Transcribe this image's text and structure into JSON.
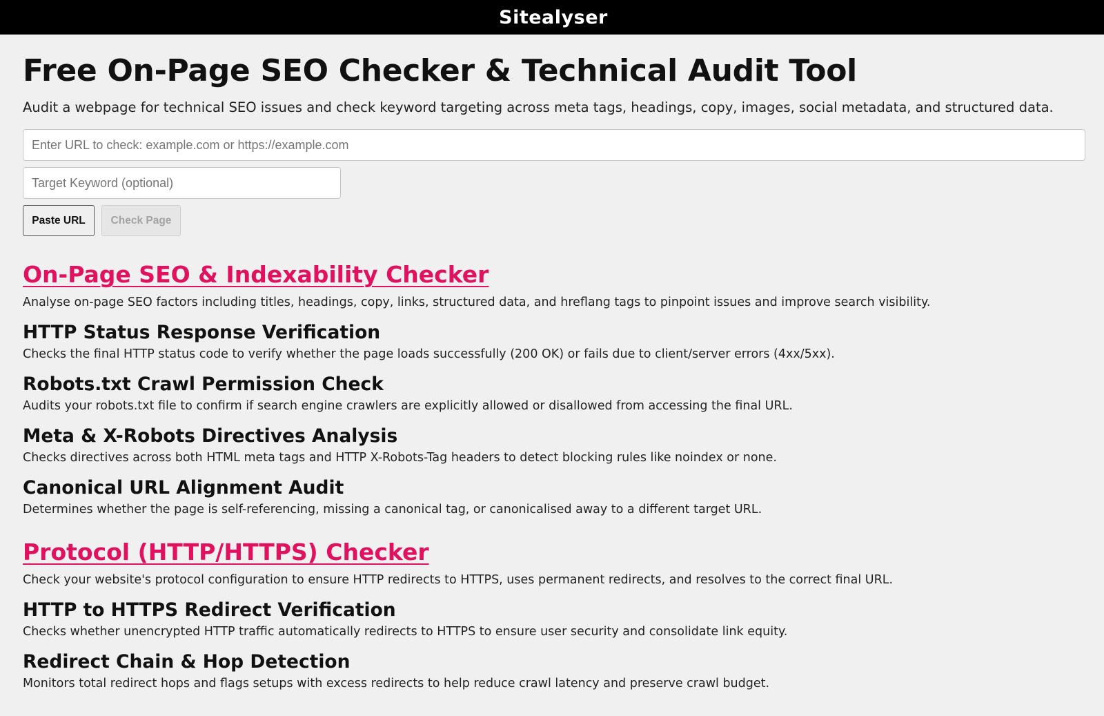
{
  "header": {
    "logo_text": "Sitealyser"
  },
  "hero": {
    "title": "Free On-Page SEO Checker & Technical Audit Tool",
    "subtitle": "Audit a webpage for technical SEO issues and check keyword targeting across meta tags, headings, copy, images, social metadata, and structured data."
  },
  "form": {
    "url_placeholder": "Enter URL to check: example.com or https://example.com",
    "url_value": "",
    "keyword_placeholder": "Target Keyword (optional)",
    "keyword_value": "",
    "paste_label": "Paste URL",
    "check_label": "Check Page",
    "check_disabled": true
  },
  "sections": [
    {
      "title": "On-Page SEO & Indexability Checker",
      "description": "Analyse on-page SEO factors including titles, headings, copy, links, structured data, and hreflang tags to pinpoint issues and improve search visibility.",
      "features": [
        {
          "title": "HTTP Status Response Verification",
          "description": "Checks the final HTTP status code to verify whether the page loads successfully (200 OK) or fails due to client/server errors (4xx/5xx)."
        },
        {
          "title": "Robots.txt Crawl Permission Check",
          "description": "Audits your robots.txt file to confirm if search engine crawlers are explicitly allowed or disallowed from accessing the final URL."
        },
        {
          "title": "Meta & X-Robots Directives Analysis",
          "description": "Checks directives across both HTML meta tags and HTTP X-Robots-Tag headers to detect blocking rules like noindex or none."
        },
        {
          "title": "Canonical URL Alignment Audit",
          "description": "Determines whether the page is self-referencing, missing a canonical tag, or canonicalised away to a different target URL."
        }
      ]
    },
    {
      "title": "Protocol (HTTP/HTTPS) Checker",
      "description": "Check your website's protocol configuration to ensure HTTP redirects to HTTPS, uses permanent redirects, and resolves to the correct final URL.",
      "features": [
        {
          "title": "HTTP to HTTPS Redirect Verification",
          "description": "Checks whether unencrypted HTTP traffic automatically redirects to HTTPS to ensure user security and consolidate link equity."
        },
        {
          "title": "Redirect Chain & Hop Detection",
          "description": "Monitors total redirect hops and flags setups with excess redirects to help reduce crawl latency and preserve crawl budget."
        }
      ]
    }
  ],
  "colors": {
    "topbar_bg": "#000000",
    "page_bg": "#f0f0f0",
    "section_link": "#e0115f"
  }
}
